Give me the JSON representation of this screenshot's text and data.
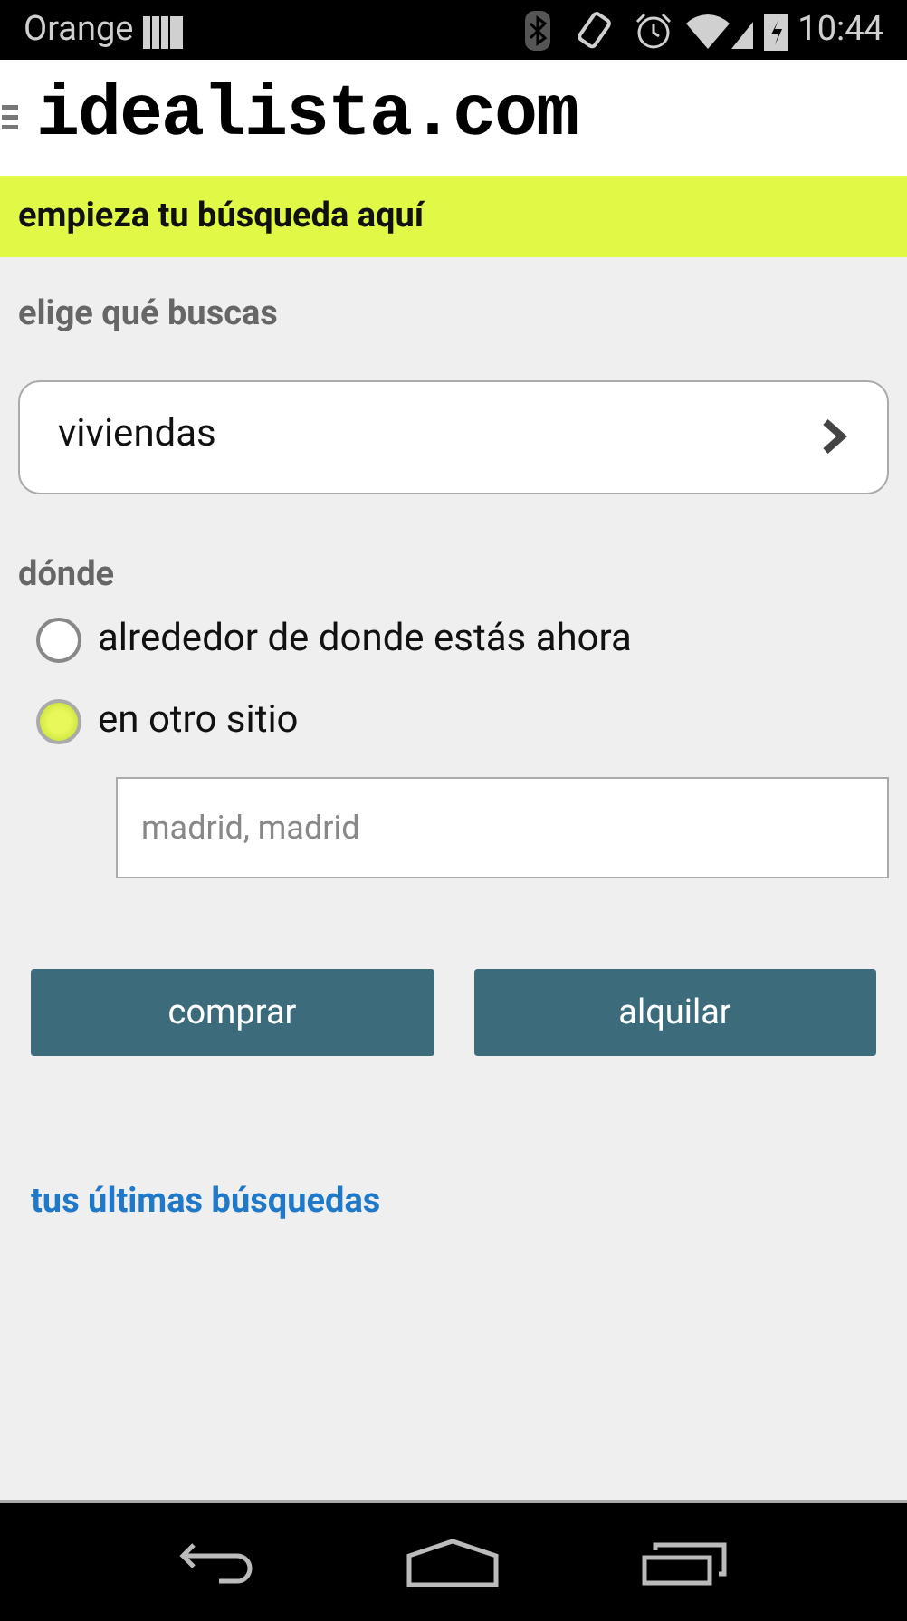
{
  "status_bar": {
    "carrier": "Orange",
    "time": "10:44"
  },
  "header": {
    "logo": "idealista.com"
  },
  "banner": "empieza tu búsqueda aquí",
  "type_section": {
    "label": "elige qué buscas",
    "value": "viviendas"
  },
  "location_section": {
    "label": "dónde",
    "options": [
      {
        "label": "alrededor de donde estás ahora",
        "selected": false
      },
      {
        "label": "en otro sitio",
        "selected": true
      }
    ],
    "field": {
      "placeholder": "madrid, madrid"
    }
  },
  "buttons": [
    "comprar",
    "alquilar"
  ],
  "recent_link": "tus últimas búsquedas"
}
